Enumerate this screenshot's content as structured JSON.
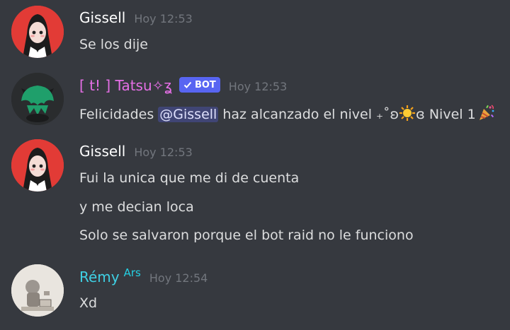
{
  "colors": {
    "background": "#36393f",
    "text": "#dcddde",
    "timestamp": "#72767d",
    "bot_name": "#e56fe6",
    "remy_name": "#3fd0e4",
    "bot_badge": "#5865f2",
    "mention": "#dee0fc"
  },
  "messages": [
    {
      "username": "Gissell",
      "timestamp": "Hoy 12:53",
      "avatar_icon": "anime-girl-avatar",
      "lines": [
        "Se los dije"
      ]
    },
    {
      "username": "[ t! ] Tatsu✧ʓ",
      "badge": "BOT",
      "badge_icon": "checkmark-icon",
      "timestamp": "Hoy 12:53",
      "avatar_icon": "green-creature-avatar",
      "line_parts": {
        "prefix": "Felicidades ",
        "mention": "@Gissell",
        "middle": " haz alcanzado el nivel ₊˚ʚ",
        "sun_icon": "sun-emoji",
        "suffix": "ɞ Nivel 1",
        "party_icon": "party-popper-emoji"
      }
    },
    {
      "username": "Gissell",
      "timestamp": "Hoy 12:53",
      "avatar_icon": "anime-girl-avatar",
      "lines": [
        "Fui la unica que me di de cuenta",
        "y me decian loca",
        "Solo se salvaron porque el bot raid no le funciono"
      ]
    },
    {
      "username": "Rémy",
      "role_tag": "Ars",
      "timestamp": "Hoy 12:54",
      "avatar_icon": "sketch-character-avatar",
      "lines": [
        "Xd"
      ]
    }
  ]
}
